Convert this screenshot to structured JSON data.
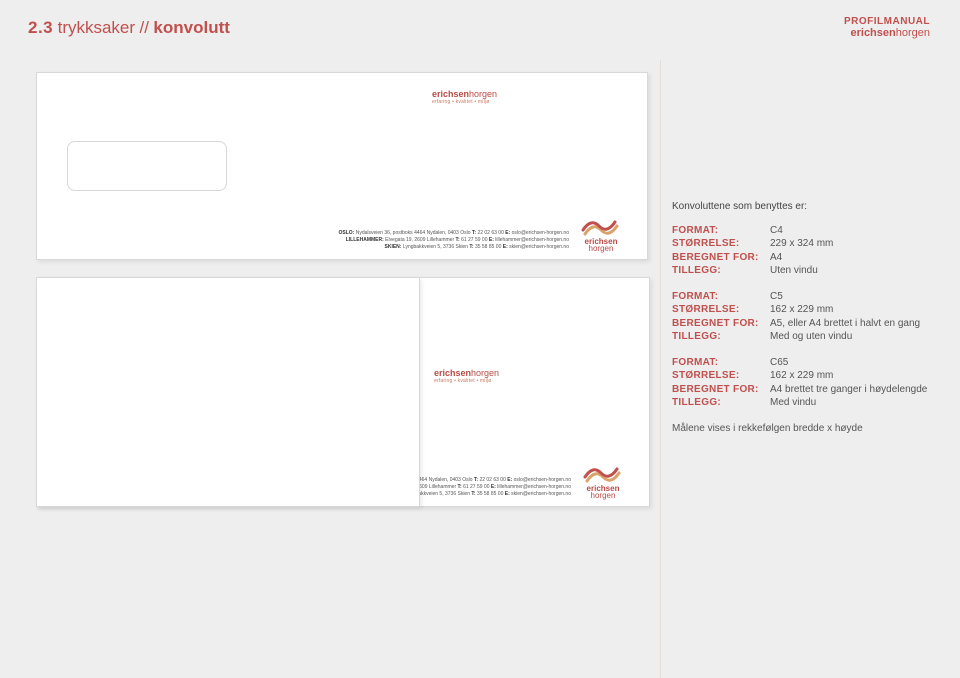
{
  "header": {
    "number": "2.3",
    "title": "trykksaker",
    "separator": "//",
    "subtitle": "konvolutt"
  },
  "manual": {
    "title": "PROFILMANUAL",
    "brand": "erichsen",
    "brand2": "horgen"
  },
  "brand": {
    "name1": "erichsen",
    "name2": "horgen",
    "tagline": "erfaring • kvalitet • miljø"
  },
  "contacts": {
    "oslo": {
      "city": "OSLO:",
      "addr": "Nydalsveien 36, postboks 4464 Nydalen, 0403 Oslo",
      "t": "T:",
      "tel": "22 02 63 00",
      "e": "E:",
      "email": "oslo@erichsen-horgen.no"
    },
    "lille": {
      "city": "LILLEHAMMER:",
      "addr": "Elvegata 19, 2609 Lillehammer",
      "t": "T:",
      "tel": "61 27 59 00",
      "e": "E:",
      "email": "lillehammer@erichsen-horgen.no"
    },
    "skien": {
      "city": "SKIEN:",
      "addr": "Lyngbakkveien 5, 3736 Skien",
      "t": "T:",
      "tel": "35 58 85 00",
      "e": "E:",
      "email": "skien@erichsen-horgen.no"
    }
  },
  "info": {
    "intro": "Konvoluttene som benyttes er:",
    "labels": {
      "format": "FORMAT:",
      "size": "STØRRELSE:",
      "for": "BEREGNET FOR:",
      "extra": "TILLEGG:"
    },
    "c4": {
      "format": "C4",
      "size": "229 x 324 mm",
      "for": "A4",
      "extra": "Uten vindu"
    },
    "c5": {
      "format": "C5",
      "size": "162 x 229 mm",
      "for": "A5, eller A4 brettet i halvt en gang",
      "extra": "Med og uten vindu"
    },
    "c65": {
      "format": "C65",
      "size": "162 x 229 mm",
      "for": "A4 brettet tre ganger i høydelengde",
      "extra": "Med vindu"
    },
    "footnote": "Målene vises i rekkefølgen bredde x høyde"
  }
}
